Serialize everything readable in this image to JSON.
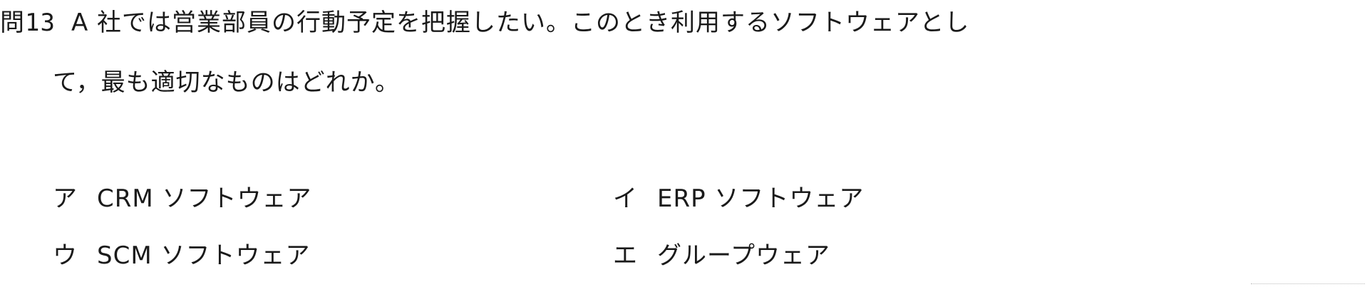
{
  "question": {
    "number": "問13",
    "line1": "A 社では営業部員の行動予定を把握したい。このとき利用するソフトウェアとし",
    "line2": "て，最も適切なものはどれか。"
  },
  "choices": [
    {
      "mark": "ア",
      "text": "CRM ソフトウェア"
    },
    {
      "mark": "イ",
      "text": "ERP ソフトウェア"
    },
    {
      "mark": "ウ",
      "text": "SCM ソフトウェア"
    },
    {
      "mark": "エ",
      "text": "グループウェア"
    }
  ]
}
